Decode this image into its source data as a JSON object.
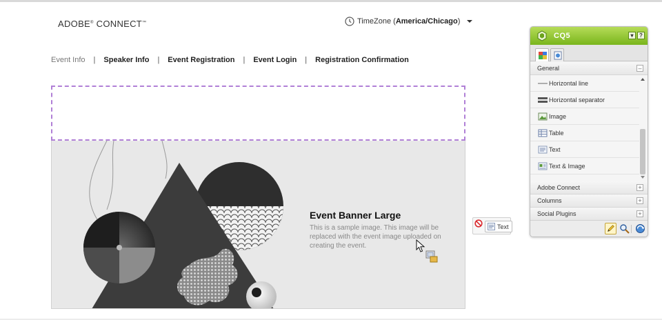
{
  "header": {
    "logo_text": "ADOBE",
    "logo_reg": "®",
    "logo_text2": " CONNECT",
    "logo_tm": "™",
    "timezone_label": "TimeZone (",
    "timezone_value": "America/Chicago",
    "timezone_close": ")"
  },
  "nav": {
    "items": [
      {
        "label": "Event Info"
      },
      {
        "label": "Speaker Info"
      },
      {
        "label": "Event Registration"
      },
      {
        "label": "Event Login"
      },
      {
        "label": "Registration Confirmation"
      }
    ],
    "separator": "|"
  },
  "banner": {
    "title": "Event Banner Large",
    "description": "This is a sample image. This image will be replaced with the event image uploaded on creating the event."
  },
  "drag": {
    "component_label": "Text"
  },
  "sidekick": {
    "title": "CQ5",
    "minimize_glyph": "▾",
    "help_glyph": "?",
    "groups": {
      "general": "General",
      "adobe_connect": "Adobe Connect",
      "columns": "Columns",
      "social_plugins": "Social Plugins"
    },
    "collapse_glyph": "–",
    "expand_glyph": "+",
    "components": [
      {
        "label": "Horizontal line",
        "icon": "horizontal-line-icon"
      },
      {
        "label": "Horizontal separator",
        "icon": "horizontal-separator-icon"
      },
      {
        "label": "Image",
        "icon": "image-icon"
      },
      {
        "label": "Table",
        "icon": "table-icon"
      },
      {
        "label": "Text",
        "icon": "text-icon"
      },
      {
        "label": "Text & Image",
        "icon": "text-image-icon"
      }
    ]
  },
  "colors": {
    "sidekick_green": "#79b51c",
    "dropzone_border": "#b07fd6"
  }
}
